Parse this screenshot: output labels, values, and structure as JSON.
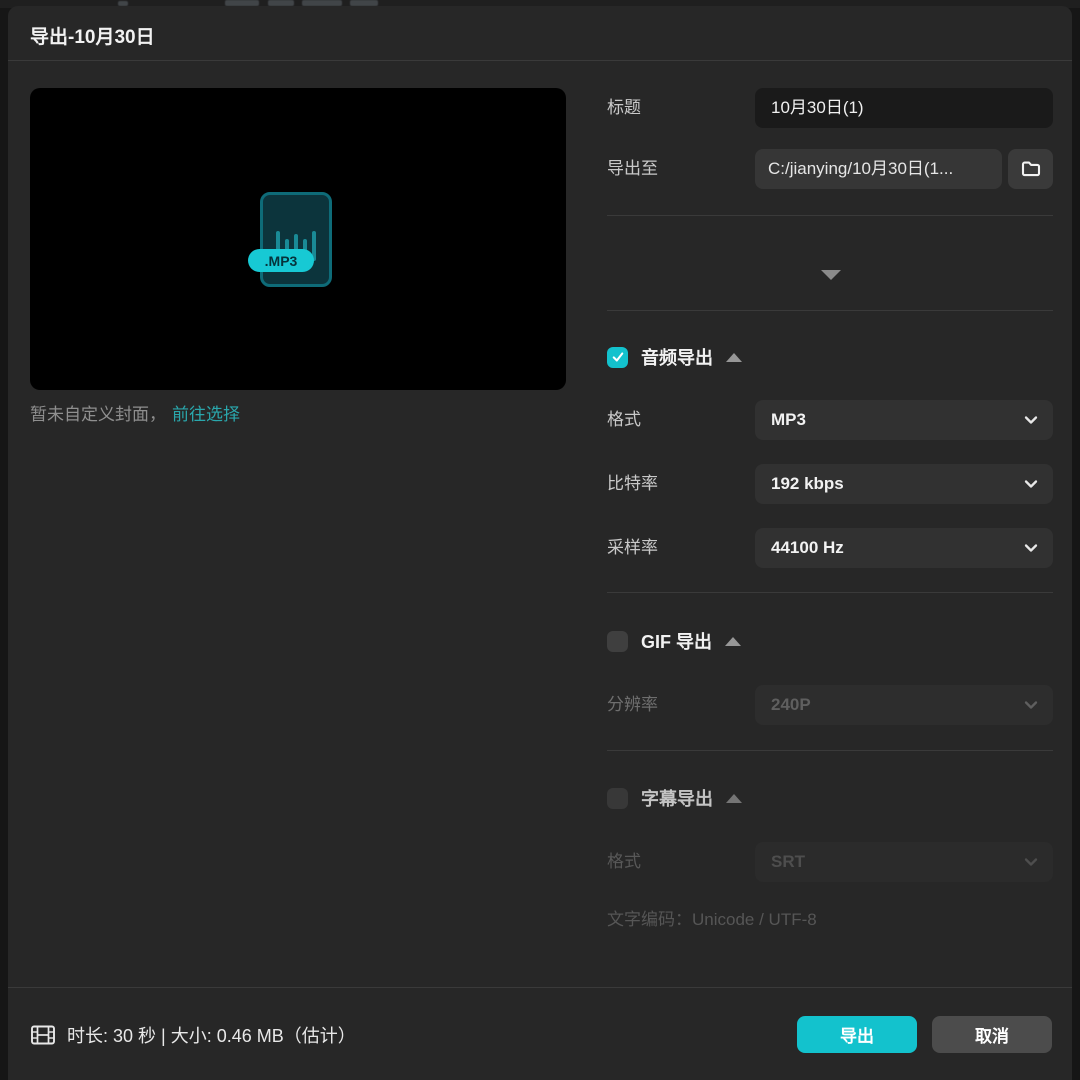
{
  "window": {
    "title": "导出-10月30日"
  },
  "preview": {
    "badge": ".MP3",
    "caption": "暂未自定义封面，",
    "link": "前往选择"
  },
  "fields": {
    "title": {
      "label": "标题",
      "value": "10月30日(1)"
    },
    "path": {
      "label": "导出至",
      "value": "C:/jianying/10月30日(1..."
    }
  },
  "audio": {
    "title": "音频导出",
    "checked": true,
    "format": {
      "label": "格式",
      "value": "MP3"
    },
    "bitrate": {
      "label": "比特率",
      "value": "192 kbps"
    },
    "samplerate": {
      "label": "采样率",
      "value": "44100 Hz"
    }
  },
  "gif": {
    "title": "GIF 导出",
    "checked": false,
    "resolution": {
      "label": "分辨率",
      "value": "240P"
    }
  },
  "subtitle": {
    "title": "字幕导出",
    "checked": false,
    "format": {
      "label": "格式",
      "value": "SRT"
    },
    "encoding": {
      "label": "文字编码：",
      "value": "Unicode / UTF-8"
    }
  },
  "footer": {
    "info": "时长:  30 秒 | 大小:  0.46 MB（估计）",
    "export_label": "导出",
    "cancel_label": "取消"
  },
  "colors": {
    "accent": "#13c2cd",
    "link": "#2aa7ac",
    "badge": "#17c9d4",
    "dialog_bg": "#272727"
  }
}
